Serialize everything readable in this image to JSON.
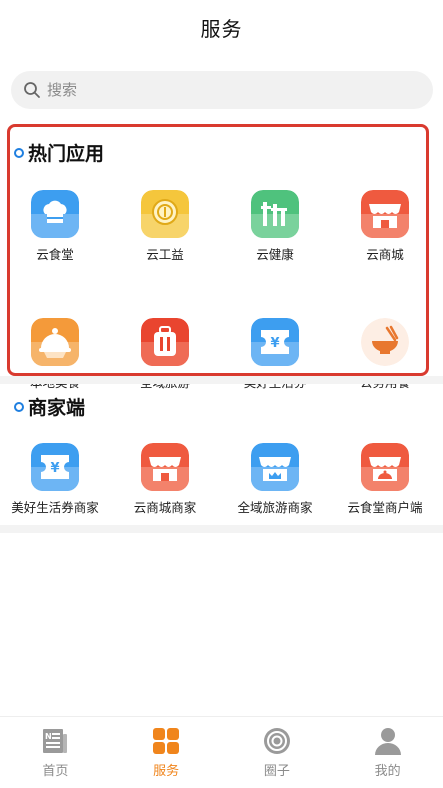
{
  "header": {
    "title": "服务"
  },
  "search": {
    "placeholder": "搜索"
  },
  "hot_section": {
    "title": "热门应用",
    "items": [
      {
        "label": "云食堂",
        "icon": "chef-hat-icon"
      },
      {
        "label": "云工益",
        "icon": "coin-icon"
      },
      {
        "label": "云健康",
        "icon": "health-icon"
      },
      {
        "label": "云商城",
        "icon": "shop-icon"
      },
      {
        "label": "本地美食",
        "icon": "food-cover-icon"
      },
      {
        "label": "全域旅游",
        "icon": "luggage-icon"
      },
      {
        "label": "美好生活券",
        "icon": "coupon-icon"
      },
      {
        "label": "公务用餐",
        "icon": "bowl-icon"
      }
    ]
  },
  "merchant_section": {
    "title": "商家端",
    "items": [
      {
        "label": "美好生活券商家",
        "icon": "coupon-icon"
      },
      {
        "label": "云商城商家",
        "icon": "shop-icon"
      },
      {
        "label": "全域旅游商家",
        "icon": "store-icon"
      },
      {
        "label": "云食堂商户端",
        "icon": "stall-icon"
      }
    ]
  },
  "tabbar": {
    "items": [
      {
        "label": "首页",
        "icon": "news-icon",
        "active": false
      },
      {
        "label": "服务",
        "icon": "grid-icon",
        "active": true
      },
      {
        "label": "圈子",
        "icon": "circle-icon",
        "active": false
      },
      {
        "label": "我的",
        "icon": "user-icon",
        "active": false
      }
    ]
  },
  "colors": {
    "accent": "#f0851c",
    "highlight_border": "#d93a2f",
    "title_dot": "#1f7fe0",
    "blue_icon": "#3d9ef0",
    "yellow_icon": "#f5c63c",
    "green_icon": "#4fc27d",
    "red_icon": "#ef5a3f",
    "orange_icon": "#f49a3a"
  }
}
